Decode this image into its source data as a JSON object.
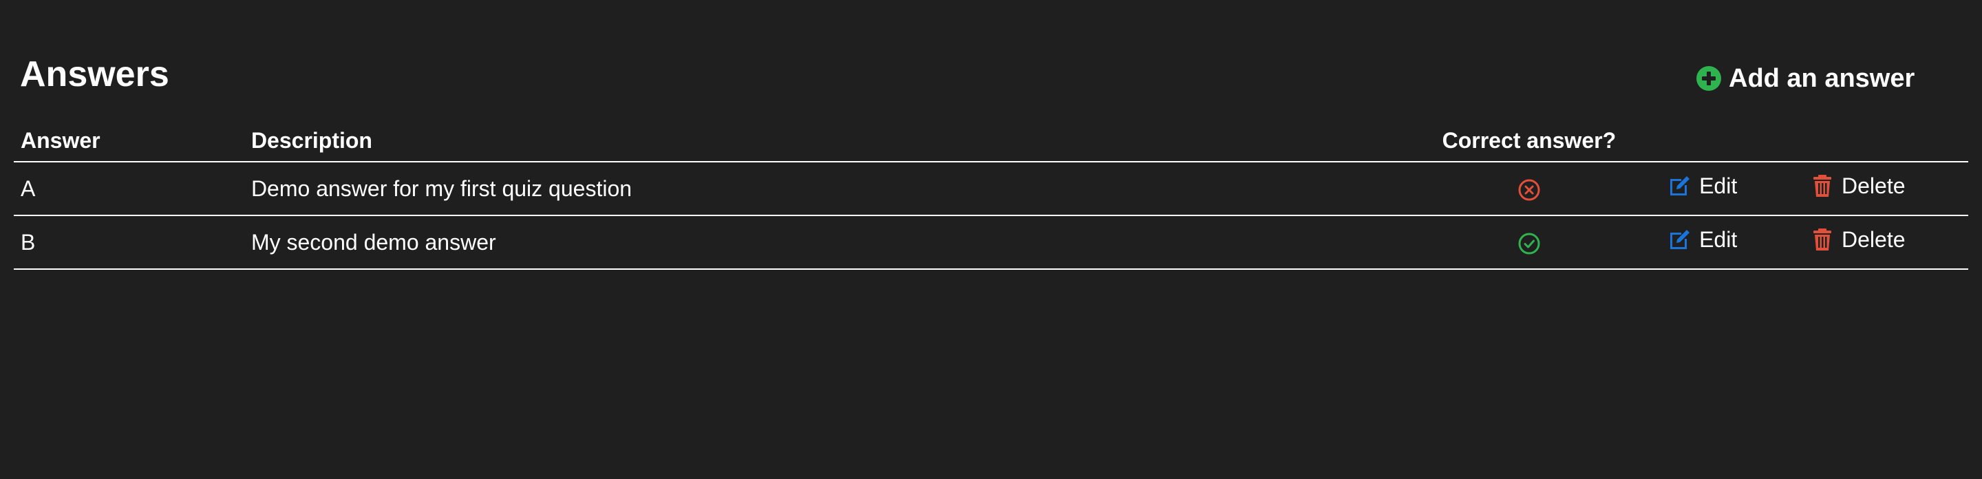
{
  "header": {
    "title": "Answers",
    "add_button_label": "Add an answer"
  },
  "table": {
    "columns": [
      "Answer",
      "Description",
      "Correct answer?"
    ],
    "rows": [
      {
        "answer": "A",
        "description": "Demo answer for my first quiz question",
        "correct": false,
        "edit_label": "Edit",
        "delete_label": "Delete"
      },
      {
        "answer": "B",
        "description": "My second demo answer",
        "correct": true,
        "edit_label": "Edit",
        "delete_label": "Delete"
      }
    ]
  },
  "icons": {
    "add": "plus-circle-icon",
    "edit": "edit-icon",
    "delete": "trash-icon",
    "correct": "check-circle-icon",
    "incorrect": "x-circle-icon"
  },
  "colors": {
    "background": "#1f1f1f",
    "text": "#ffffff",
    "add_green": "#2fb34f",
    "edit_blue": "#1b74d9",
    "delete_red": "#e0503a",
    "incorrect_red": "#e0503a",
    "correct_green": "#2fb34f"
  }
}
